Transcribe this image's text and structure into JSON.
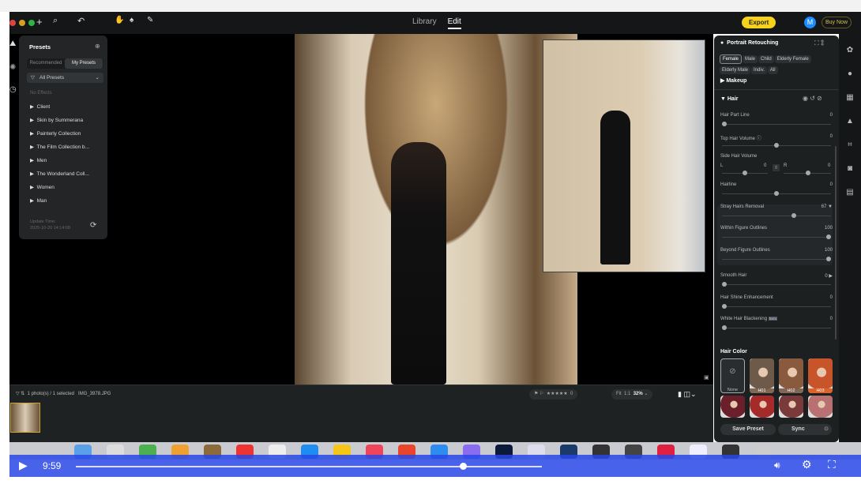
{
  "toolbar": {
    "tabs": [
      "Library",
      "Edit"
    ],
    "active_tab": "Edit",
    "export": "Export",
    "avatar": "M",
    "buy_now": "Buy Now"
  },
  "presets": {
    "title": "Presets",
    "tabs": [
      "Recommended",
      "My Presets"
    ],
    "active_tab": "My Presets",
    "filter": "All Presets",
    "no_effects": "No Effects",
    "items": [
      "Client",
      "Skin by Summerana",
      "Painterly Collection",
      "The Film Collection b...",
      "Men",
      "The Wonderland Coll...",
      "Women",
      "Man"
    ],
    "update_label": "Update Time:",
    "update_time": "2025-10-20 14:14:08"
  },
  "filmstrip": {
    "count": "1 photo(s) / 1 selected",
    "filename": "IMG_3978.JPG",
    "fit": "Fit",
    "one": "1:1",
    "zoom": "32%",
    "rating_value": "0"
  },
  "panel": {
    "title": "Portrait Retouching",
    "chips": [
      "Female",
      "Male",
      "Child",
      "Elderly Female",
      "Elderly Male",
      "Indiv.",
      "All"
    ],
    "active_chip": "Female",
    "makeup": "Makeup",
    "hair": "Hair",
    "sliders": [
      {
        "label": "Hair Part Line",
        "value": "0",
        "pos": 0
      },
      {
        "label": "Top Hair Volume",
        "value": "0",
        "pos": 0.5
      },
      {
        "label": "Hairline",
        "value": "0",
        "pos": 0.5
      },
      {
        "label": "Stray Hairs Removal",
        "value": "67",
        "pos": 0.67
      },
      {
        "label": "Within Figure Outlines",
        "value": "100",
        "pos": 1
      },
      {
        "label": "Beyond Figure Outlines",
        "value": "100",
        "pos": 1
      },
      {
        "label": "Smooth Hair",
        "value": "0",
        "pos": 0
      },
      {
        "label": "Hair Shine Enhancement",
        "value": "0",
        "pos": 0
      },
      {
        "label": "White Hair Blackening",
        "value": "0",
        "pos": 0
      }
    ],
    "side_hair": {
      "label": "Side Hair Volume",
      "l": "L",
      "l_value": "0",
      "r": "R",
      "r_value": "0"
    },
    "beta": "Beta",
    "hair_color": "Hair Color",
    "swatches": [
      {
        "label": "None",
        "color": "#2a2d2f"
      },
      {
        "label": "H01",
        "color": "#6e5a48"
      },
      {
        "label": "H02",
        "color": "#8a5a3e"
      },
      {
        "label": "H03",
        "color": "#c8552a"
      },
      {
        "label": "",
        "color": "#6a1f2a"
      },
      {
        "label": "",
        "color": "#a52a2a"
      },
      {
        "label": "",
        "color": "#7a3a3a"
      },
      {
        "label": "",
        "color": "#b87070"
      }
    ],
    "save_preset": "Save Preset",
    "sync": "Sync"
  },
  "video": {
    "time": "9:59",
    "progress": 0.83
  }
}
